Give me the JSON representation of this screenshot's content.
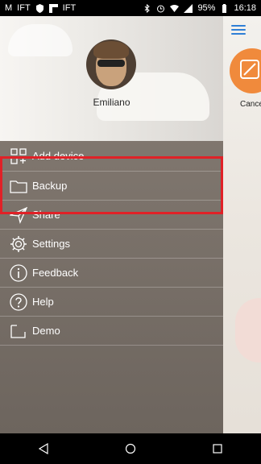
{
  "status_bar": {
    "battery": "95%",
    "time": "16:18",
    "left_icons": [
      "notification-m-icon",
      "ifttt-icon",
      "shield-icon",
      "flipboard-icon",
      "ifttt-icon"
    ],
    "right_icons": [
      "bluetooth-icon",
      "alarm-icon",
      "wifi-icon",
      "signal-icon",
      "battery-icon"
    ]
  },
  "drawer": {
    "profile_name": "Emiliano",
    "menu": [
      {
        "label": "Add device",
        "icon": "add-device-icon"
      },
      {
        "label": "Backup",
        "icon": "folder-icon"
      },
      {
        "label": "Share",
        "icon": "send-icon"
      },
      {
        "label": "Settings",
        "icon": "gear-icon"
      },
      {
        "label": "Feedback",
        "icon": "info-icon"
      },
      {
        "label": "Help",
        "icon": "help-icon"
      },
      {
        "label": "Demo",
        "icon": "demo-icon"
      }
    ]
  },
  "background_app": {
    "cancel_label": "Cance",
    "accent_color": "#f08a3c",
    "menu_color": "#2f7fd6"
  },
  "highlight_color": "#e02127"
}
